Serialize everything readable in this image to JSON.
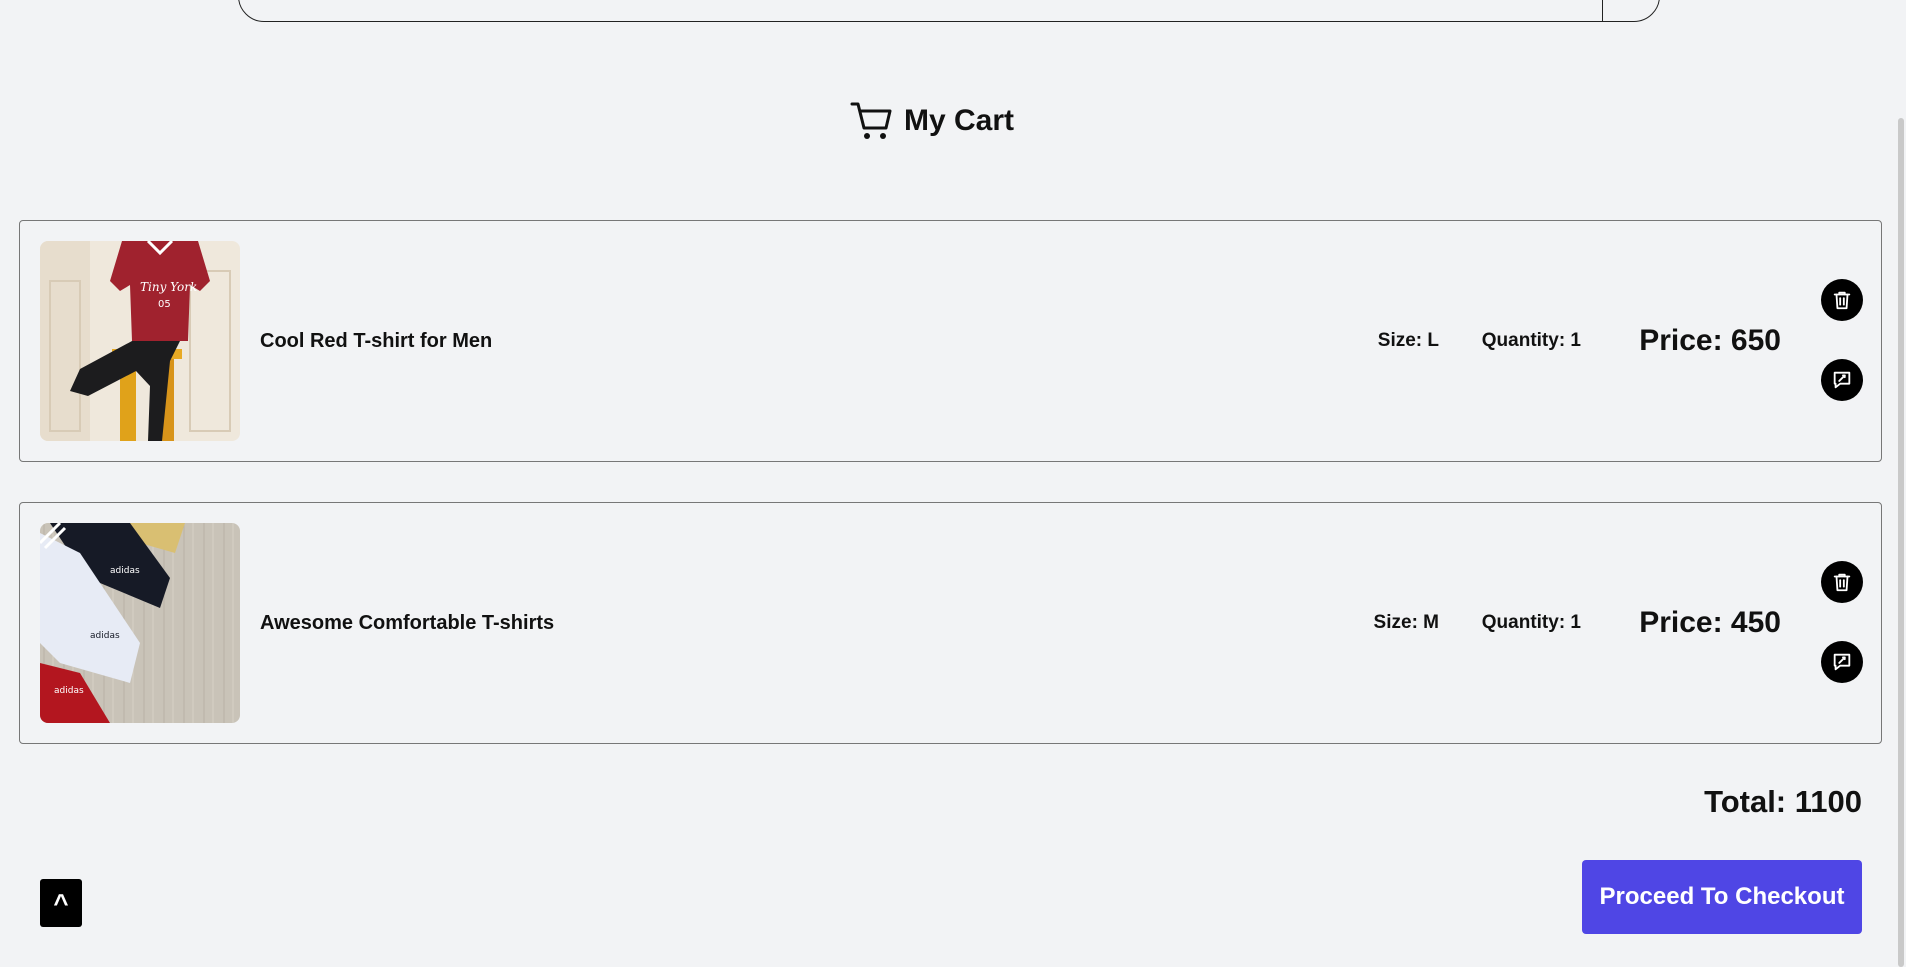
{
  "header": {
    "title": "My Cart"
  },
  "cart": {
    "items": [
      {
        "name": "Cool Red T-shirt for Men",
        "size": "Size: L",
        "quantity": "Quantity: 1",
        "price": "Price: 650"
      },
      {
        "name": "Awesome Comfortable T-shirts",
        "size": "Size: M",
        "quantity": "Quantity: 1",
        "price": "Price: 450"
      }
    ],
    "total": "Total: 1100",
    "checkout_label": "Proceed To Checkout"
  },
  "scroll_top_label": "^",
  "colors": {
    "accent": "#4f46e5",
    "background": "#f2f3f5",
    "icon_button": "#000000"
  },
  "icons": {
    "cart": "cart-icon",
    "delete": "trash-icon",
    "edit": "edit-icon"
  }
}
